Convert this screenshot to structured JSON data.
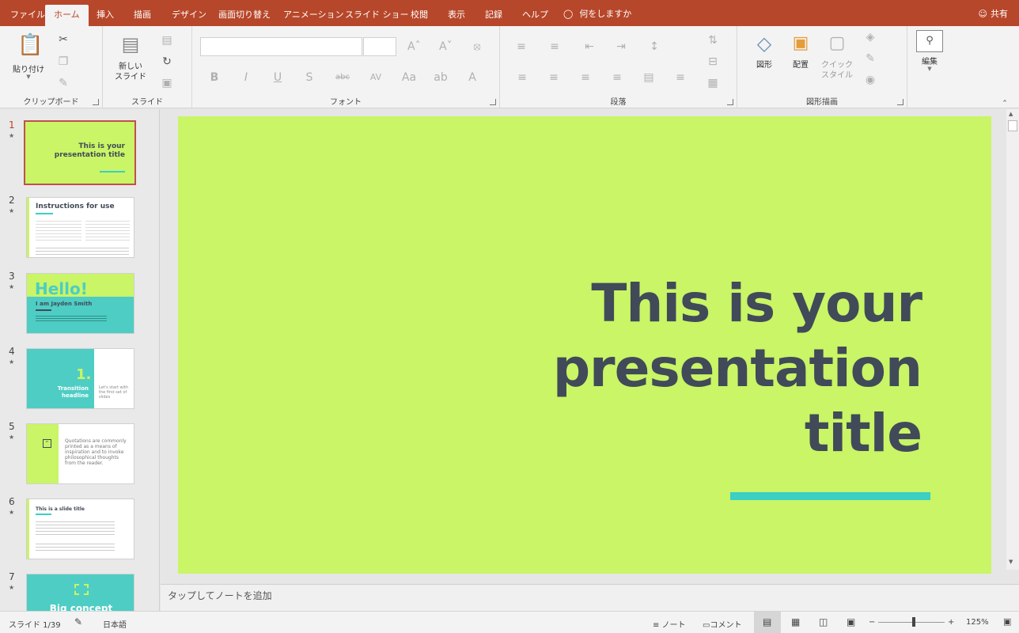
{
  "tabs": [
    {
      "label": "ファイル"
    },
    {
      "label": "ホーム"
    },
    {
      "label": "挿入"
    },
    {
      "label": "描画"
    },
    {
      "label": "デザイン"
    },
    {
      "label": "画面切り替え"
    },
    {
      "label": "アニメーション"
    },
    {
      "label": "スライド ショー"
    },
    {
      "label": "校閲"
    },
    {
      "label": "表示"
    },
    {
      "label": "記録"
    },
    {
      "label": "ヘルプ"
    }
  ],
  "active_tab": "ホーム",
  "tell_me": "何をしますか",
  "share": "共有",
  "ribbon": {
    "clipboard": {
      "label": "クリップボード",
      "paste": "貼り付け"
    },
    "slides": {
      "label": "スライド",
      "new_slide_1": "新しい",
      "new_slide_2": "スライド"
    },
    "font": {
      "label": "フォント"
    },
    "paragraph": {
      "label": "段落"
    },
    "drawing": {
      "label": "図形描画",
      "shapes": "図形",
      "arrange": "配置",
      "quick_style_1": "クイック",
      "quick_style_2": "スタイル"
    },
    "editing": {
      "label": "編集"
    }
  },
  "thumbnails": [
    {
      "num": "1",
      "title": "This is your presentation title"
    },
    {
      "num": "2",
      "title": "Instructions for use"
    },
    {
      "num": "3",
      "title": "Hello!",
      "subtitle": "I am Jayden Smith"
    },
    {
      "num": "4",
      "title": "1.",
      "subtitle": "Transition headline",
      "side": "Let's start with the first set of slides"
    },
    {
      "num": "5",
      "title": "Quotations are commonly printed as a means of inspiration and to invoke philosophical thoughts from the reader."
    },
    {
      "num": "6",
      "title": "This is a slide title"
    },
    {
      "num": "7",
      "title": "Big concept"
    }
  ],
  "slide": {
    "title_line1": "This is your",
    "title_line2": "presentation",
    "title_line3": "title"
  },
  "notes_placeholder": "タップしてノートを追加",
  "status": {
    "slide_indicator": "スライド 1/39",
    "language": "日本語",
    "notes": "ノート",
    "comments": "コメント",
    "zoom": "125%"
  },
  "colors": {
    "accent": "#b7472a",
    "slide_bg": "#c9f566",
    "teal": "#3ccfc3",
    "title_text": "#414a58"
  }
}
